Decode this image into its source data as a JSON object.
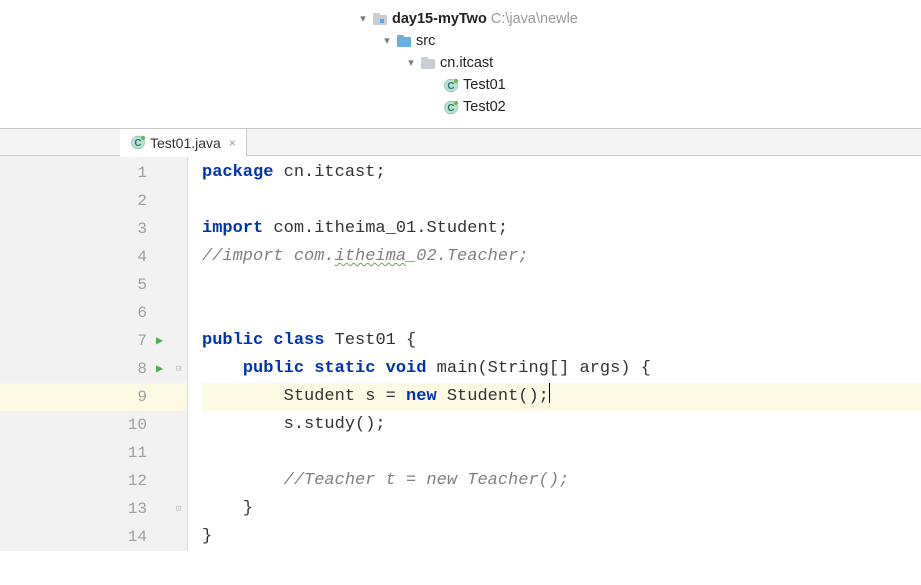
{
  "tree": {
    "project": {
      "name": "day15-myTwo",
      "path": "C:\\java\\newle"
    },
    "src": "src",
    "pkg": "cn.itcast",
    "classes": [
      "Test01",
      "Test02"
    ]
  },
  "tab": {
    "title": "Test01.java",
    "close": "×"
  },
  "gutter": {
    "nums": [
      "1",
      "2",
      "3",
      "4",
      "5",
      "6",
      "7",
      "8",
      "9",
      "10",
      "11",
      "12",
      "13",
      "14"
    ],
    "run_lines": [
      7,
      8
    ],
    "fold_open": [
      8
    ],
    "fold_close": [
      13
    ],
    "highlight_line": 9
  },
  "code": {
    "l1": {
      "kw": "package",
      "rest": " cn.itcast;"
    },
    "l3": {
      "kw": "import",
      "rest": " com.itheima_01.Student;"
    },
    "l4a": "//import com.",
    "l4b": "itheima",
    "l4c": "_02.Teacher;",
    "l7a": "public",
    "l7b": "class",
    "l7c": " Test01 {",
    "l8a": "public",
    "l8b": "static",
    "l8c": "void",
    "l8d": " main(String[] args) {",
    "l9a": "        Student s = ",
    "l9b": "new",
    "l9c": " Student();",
    "l10": "        s.study();",
    "l12": "        //Teacher t = new Teacher();",
    "l13": "    }",
    "l14": "}"
  }
}
